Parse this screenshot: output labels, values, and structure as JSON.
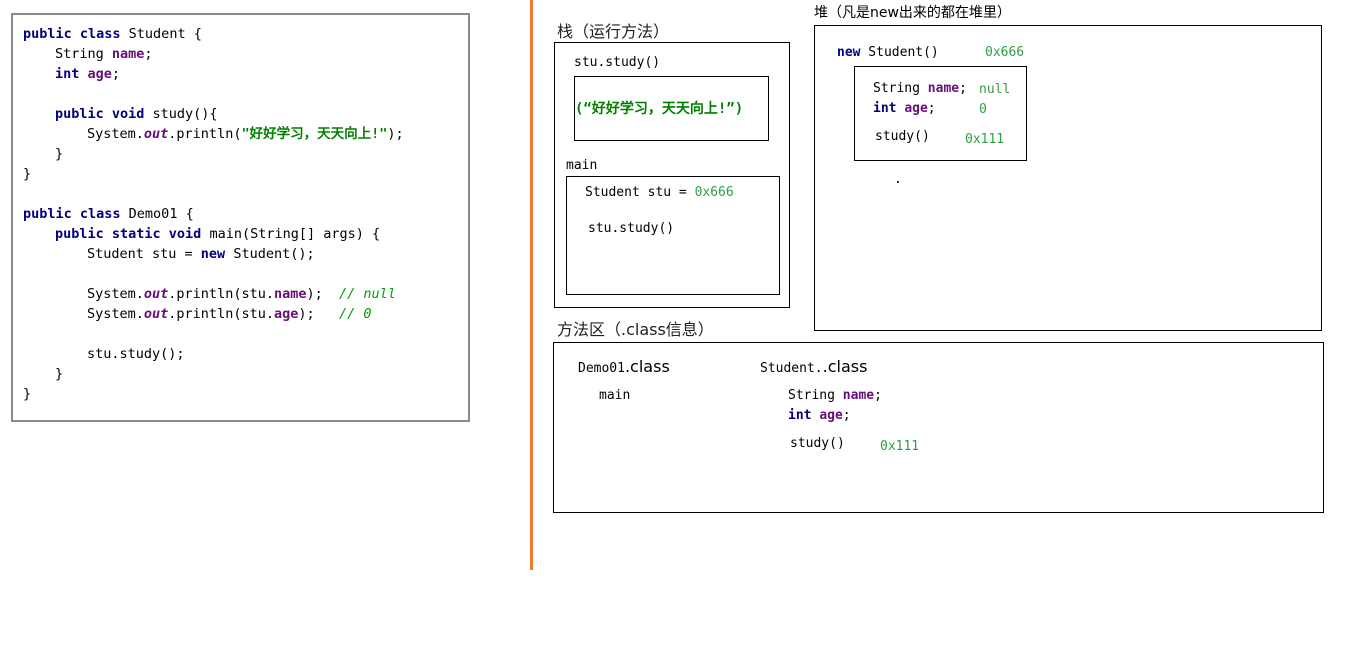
{
  "code": {
    "line1": {
      "kw": "public class",
      "rest": " Student {"
    },
    "line2": {
      "type": "String ",
      "field": "name",
      "end": ";"
    },
    "line3": {
      "kw": "int",
      "sp": " ",
      "field": "age",
      "end": ";"
    },
    "line4": {
      "kw": "public void",
      "rest": " study(){"
    },
    "line5": {
      "pre": "System.",
      "out": "out",
      "mid": ".println(",
      "str": "\"好好学习，天天向上!\"",
      "end": ");"
    },
    "line6": "}",
    "line7": "}",
    "line8": {
      "kw": "public class",
      "rest": " Demo01 {"
    },
    "line9": {
      "kw": "public static void",
      "rest": " main(String[] args) {"
    },
    "line10": {
      "pre": "Student stu = ",
      "kw": "new",
      "rest": " Student();"
    },
    "line11": {
      "pre": "System.",
      "out": "out",
      "mid": ".println(stu.",
      "field": "name",
      "end": ");  ",
      "comment": "// null"
    },
    "line12": {
      "pre": "System.",
      "out": "out",
      "mid": ".println(stu.",
      "field": "age",
      "end": ");   ",
      "comment": "// 0"
    },
    "line13": "stu.study();",
    "line14": "}",
    "line15": "}"
  },
  "stack": {
    "title": "栈（运行方法）",
    "frame_study": {
      "label": "stu.study()",
      "output": "(“好好学习，天天向上!”)"
    },
    "frame_main": {
      "label": "main",
      "var": "Student stu = ",
      "var_addr": "0x666",
      "call": "stu.study()"
    }
  },
  "heap": {
    "title": "堆（凡是new出来的都在堆里）",
    "object_header": {
      "kw": "new",
      "rest": " Student()",
      "addr": "0x666"
    },
    "field_name": {
      "type": "String ",
      "name": "name",
      "end": ";",
      "value": "null"
    },
    "field_age": {
      "type": "int",
      "name": "age",
      "end": ";",
      "value": "0"
    },
    "method": {
      "label": "study()",
      "addr": "0x111"
    },
    "dot": "."
  },
  "method_area": {
    "title": "方法区（.class信息）",
    "demo_class": {
      "name": "Demo01",
      "ext": ".class",
      "method": "main"
    },
    "student_class": {
      "name": "Student.",
      "ext": ".class",
      "field_name": {
        "type": "String ",
        "name": "name",
        "end": ";"
      },
      "field_age": {
        "type": "int",
        "name": "age",
        "end": ";"
      },
      "method": "study()",
      "method_addr": "0x111"
    }
  }
}
